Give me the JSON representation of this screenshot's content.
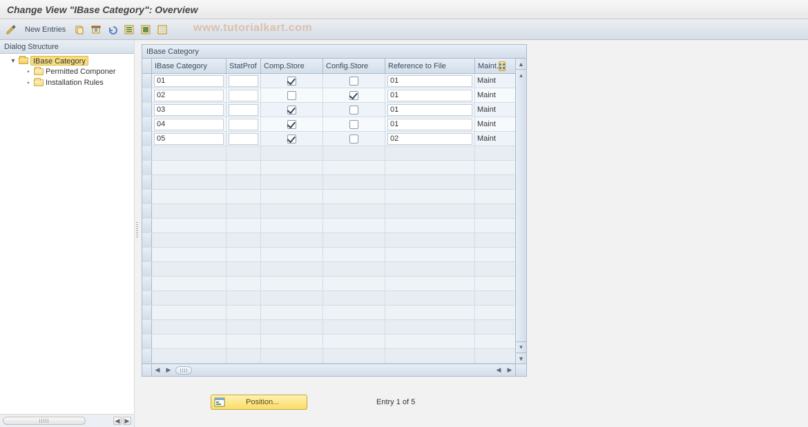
{
  "title": "Change View \"IBase Category\": Overview",
  "watermark": "www.tutorialkart.com",
  "toolbar": {
    "new_entries_label": "New Entries"
  },
  "sidebar": {
    "header": "Dialog Structure",
    "nodes": [
      {
        "label": "IBase Category",
        "level": 1,
        "open": true,
        "selected": true
      },
      {
        "label": "Permitted Componer",
        "level": 2,
        "open": false,
        "selected": false
      },
      {
        "label": "Installation Rules",
        "level": 2,
        "open": false,
        "selected": false
      }
    ]
  },
  "grid": {
    "title": "IBase Category",
    "columns": [
      {
        "key": "cat",
        "label": "IBase Category"
      },
      {
        "key": "stat",
        "label": "StatProf"
      },
      {
        "key": "comp",
        "label": "Comp.Store"
      },
      {
        "key": "conf",
        "label": "Config.Store"
      },
      {
        "key": "ref",
        "label": "Reference to File"
      },
      {
        "key": "maint",
        "label": "Maint."
      }
    ],
    "rows": [
      {
        "cat": "01",
        "stat": "",
        "comp": true,
        "conf": false,
        "ref": "01",
        "maint": "Maint"
      },
      {
        "cat": "02",
        "stat": "",
        "comp": false,
        "conf": true,
        "ref": "01",
        "maint": "Maint"
      },
      {
        "cat": "03",
        "stat": "",
        "comp": true,
        "conf": false,
        "ref": "01",
        "maint": "Maint"
      },
      {
        "cat": "04",
        "stat": "",
        "comp": true,
        "conf": false,
        "ref": "01",
        "maint": "Maint"
      },
      {
        "cat": "05",
        "stat": "",
        "comp": true,
        "conf": false,
        "ref": "02",
        "maint": "Maint"
      }
    ],
    "empty_rows": 15
  },
  "footer": {
    "position_label": "Position...",
    "entry_text": "Entry 1 of 5"
  }
}
